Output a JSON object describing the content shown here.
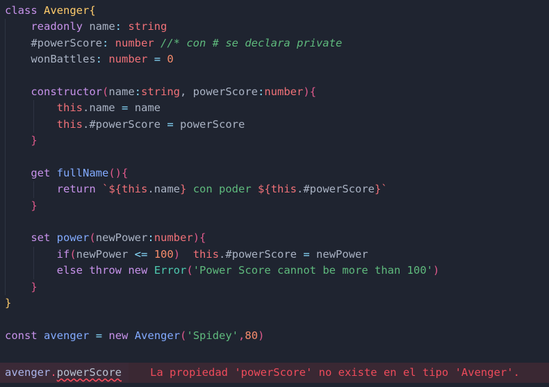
{
  "editor": {
    "language": "TypeScript",
    "theme_background": "#1f2430",
    "font_size_px": 15.5,
    "lines": [
      {
        "n": 1,
        "indent": 0,
        "text": "class Avenger{"
      },
      {
        "n": 2,
        "indent": 1,
        "text": "readonly name: string"
      },
      {
        "n": 3,
        "indent": 1,
        "text": "#powerScore: number //* con # se declara private"
      },
      {
        "n": 4,
        "indent": 1,
        "text": "wonBattles: number = 0"
      },
      {
        "n": 5,
        "indent": 0,
        "text": ""
      },
      {
        "n": 6,
        "indent": 1,
        "text": "constructor(name:string, powerScore:number){"
      },
      {
        "n": 7,
        "indent": 2,
        "text": "this.name = name"
      },
      {
        "n": 8,
        "indent": 2,
        "text": "this.#powerScore = powerScore"
      },
      {
        "n": 9,
        "indent": 1,
        "text": "}"
      },
      {
        "n": 10,
        "indent": 0,
        "text": ""
      },
      {
        "n": 11,
        "indent": 1,
        "text": "get fullName(){"
      },
      {
        "n": 12,
        "indent": 2,
        "text": "return `${this.name} con poder ${this.#powerScore}`"
      },
      {
        "n": 13,
        "indent": 1,
        "text": "}"
      },
      {
        "n": 14,
        "indent": 0,
        "text": ""
      },
      {
        "n": 15,
        "indent": 1,
        "text": "set power(newPower:number){"
      },
      {
        "n": 16,
        "indent": 2,
        "text": "if(newPower <= 100)  this.#powerScore = newPower"
      },
      {
        "n": 17,
        "indent": 2,
        "text": "else throw new Error('Power Score cannot be more than 100')"
      },
      {
        "n": 18,
        "indent": 1,
        "text": "}"
      },
      {
        "n": 19,
        "indent": 0,
        "text": "}"
      },
      {
        "n": 20,
        "indent": 0,
        "text": ""
      },
      {
        "n": 21,
        "indent": 0,
        "text": "const avenger = new Avenger('Spidey',80)"
      }
    ],
    "tokens": {
      "l1": {
        "kw": "class",
        "cls": "Avenger",
        "brace": "{"
      },
      "l2": {
        "kw": "readonly",
        "name": "name",
        "colon": ":",
        "type": "string"
      },
      "l3": {
        "name": "#powerScore",
        "colon": ":",
        "type": "number",
        "comment": "//* con # se declara private"
      },
      "l4": {
        "name": "wonBattles",
        "colon": ":",
        "type": "number",
        "eq": "=",
        "num": "0"
      },
      "l6": {
        "kw": "constructor",
        "lp": "(",
        "p1": "name",
        "c1": ":",
        "t1": "string",
        "comma": ", ",
        "p2": "powerScore",
        "c2": ":",
        "t2": "number",
        "rp": ")",
        "brace": "{"
      },
      "l7": {
        "this": "this",
        "dot_prop": ".name",
        "eq": "=",
        "val": "name"
      },
      "l8": {
        "this": "this",
        "dot_prop": ".#powerScore",
        "eq": "=",
        "val": "powerScore"
      },
      "l9": {
        "brace": "}"
      },
      "l11": {
        "kw": "get",
        "name": "fullName",
        "parens": "()",
        "brace": "{"
      },
      "l12": {
        "kw": "return",
        "tick_open": "`",
        "i1_open": "${",
        "this1": "this",
        "prop1": ".name",
        "i1_close": "}",
        "text": " con poder ",
        "i2_open": "${",
        "this2": "this",
        "prop2": ".#powerScore",
        "i2_close": "}",
        "tick_close": "`"
      },
      "l13": {
        "brace": "}"
      },
      "l15": {
        "kw": "set",
        "name": "power",
        "lp": "(",
        "p1": "newPower",
        "colon": ":",
        "type": "number",
        "rp": ")",
        "brace": "{"
      },
      "l16": {
        "kw": "if",
        "lp": "(",
        "var": "newPower",
        "op": "<=",
        "num": "100",
        "rp": ")",
        "gap": "  ",
        "this": "this",
        "prop": ".#powerScore",
        "eq": "=",
        "val": "newPower"
      },
      "l17": {
        "kw1": "else",
        "kw2": "throw",
        "kw3": "new",
        "errcls": "Error",
        "lp": "(",
        "str": "'Power Score cannot be more than 100'",
        "rp": ")"
      },
      "l18": {
        "brace": "}"
      },
      "l19": {
        "brace": "}"
      },
      "l21": {
        "kw1": "const",
        "var": "avenger",
        "eq": "=",
        "kw2": "new",
        "cls": "Avenger",
        "lp": "(",
        "str": "'Spidey'",
        "comma": ",",
        "num": "80",
        "rp": ")"
      }
    }
  },
  "error_line": {
    "code_variable": "avenger",
    "code_dot": ".",
    "code_property": "powerScore",
    "message": "La propiedad 'powerScore' no existe en el tipo 'Avenger'.",
    "message_color": "#ef4b5b",
    "underline_color": "#ff4d5e",
    "strip_background": "#3a2833"
  }
}
